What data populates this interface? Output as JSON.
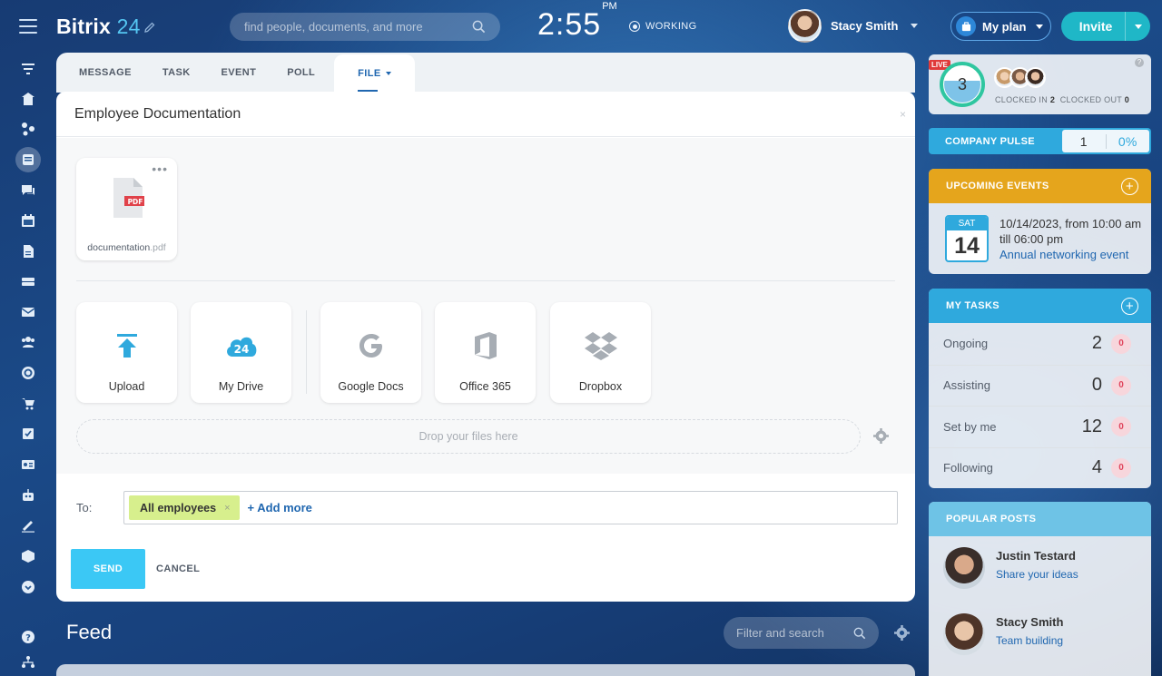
{
  "header": {
    "logo_main": "Bitrix",
    "logo_num": "24",
    "search_placeholder": "find people, documents, and more",
    "clock_time": "2:55",
    "clock_ampm": "PM",
    "status": "WORKING",
    "user_name": "Stacy Smith",
    "plan_label": "My plan",
    "invite_label": "Invite"
  },
  "composer": {
    "tabs": [
      "MESSAGE",
      "TASK",
      "EVENT",
      "POLL",
      "FILE"
    ],
    "active_tab": "FILE",
    "title": "Employee Documentation",
    "close_glyph": "×",
    "file": {
      "name": "documentation",
      "ext": ".pdf",
      "type_badge": "PDF"
    },
    "sources": [
      "Upload",
      "My Drive",
      "Google Docs",
      "Office 365",
      "Dropbox"
    ],
    "drive_badge": "24",
    "dropzone_text": "Drop your files here",
    "to_label": "To:",
    "recipient_chip": "All employees",
    "chip_remove": "×",
    "add_more": "+ Add more",
    "send_label": "SEND",
    "cancel_label": "CANCEL"
  },
  "feed": {
    "title": "Feed",
    "search_placeholder": "Filter and search"
  },
  "widgets": {
    "live_badge": "LIVE",
    "clocked_count": "3",
    "clocked_in_label": "CLOCKED IN",
    "clocked_in": "2",
    "clocked_out_label": "CLOCKED OUT",
    "clocked_out": "0",
    "help_glyph": "?",
    "pulse_label": "COMPANY PULSE",
    "pulse_value": "1",
    "pulse_percent": "0%",
    "events_title": "UPCOMING EVENTS",
    "event_day": "SAT",
    "event_date_num": "14",
    "event_when": "10/14/2023, from 10:00 am till 06:00 pm",
    "event_name": "Annual networking event",
    "tasks_title": "MY TASKS",
    "tasks": [
      {
        "name": "Ongoing",
        "count": "2",
        "badge": "0"
      },
      {
        "name": "Assisting",
        "count": "0",
        "badge": "0"
      },
      {
        "name": "Set by me",
        "count": "12",
        "badge": "0"
      },
      {
        "name": "Following",
        "count": "4",
        "badge": "0"
      }
    ],
    "popular_title": "POPULAR POSTS",
    "posts": [
      {
        "author": "Justin Testard",
        "title": "Share your ideas"
      },
      {
        "author": "Stacy Smith",
        "title": "Team building"
      }
    ]
  },
  "colors": {
    "accent": "#3bc8f5",
    "events_header": "#e5a51c",
    "tasks_header": "#2fa9dd",
    "popular_header": "#6ec3e6",
    "chip": "#d7ef8d",
    "link": "#2067b0"
  },
  "icons": {
    "rail": [
      "menu-icon",
      "filter-icon",
      "home-icon",
      "collab-icon",
      "feed-icon",
      "chat-icon",
      "calendar-icon",
      "document-icon",
      "drive-icon",
      "mail-icon",
      "team-icon",
      "goal-icon",
      "cart-icon",
      "tasks-icon",
      "crm-icon",
      "robot-icon",
      "sign-icon",
      "store-icon",
      "more-icon",
      "help-icon",
      "sitemap-icon"
    ]
  }
}
